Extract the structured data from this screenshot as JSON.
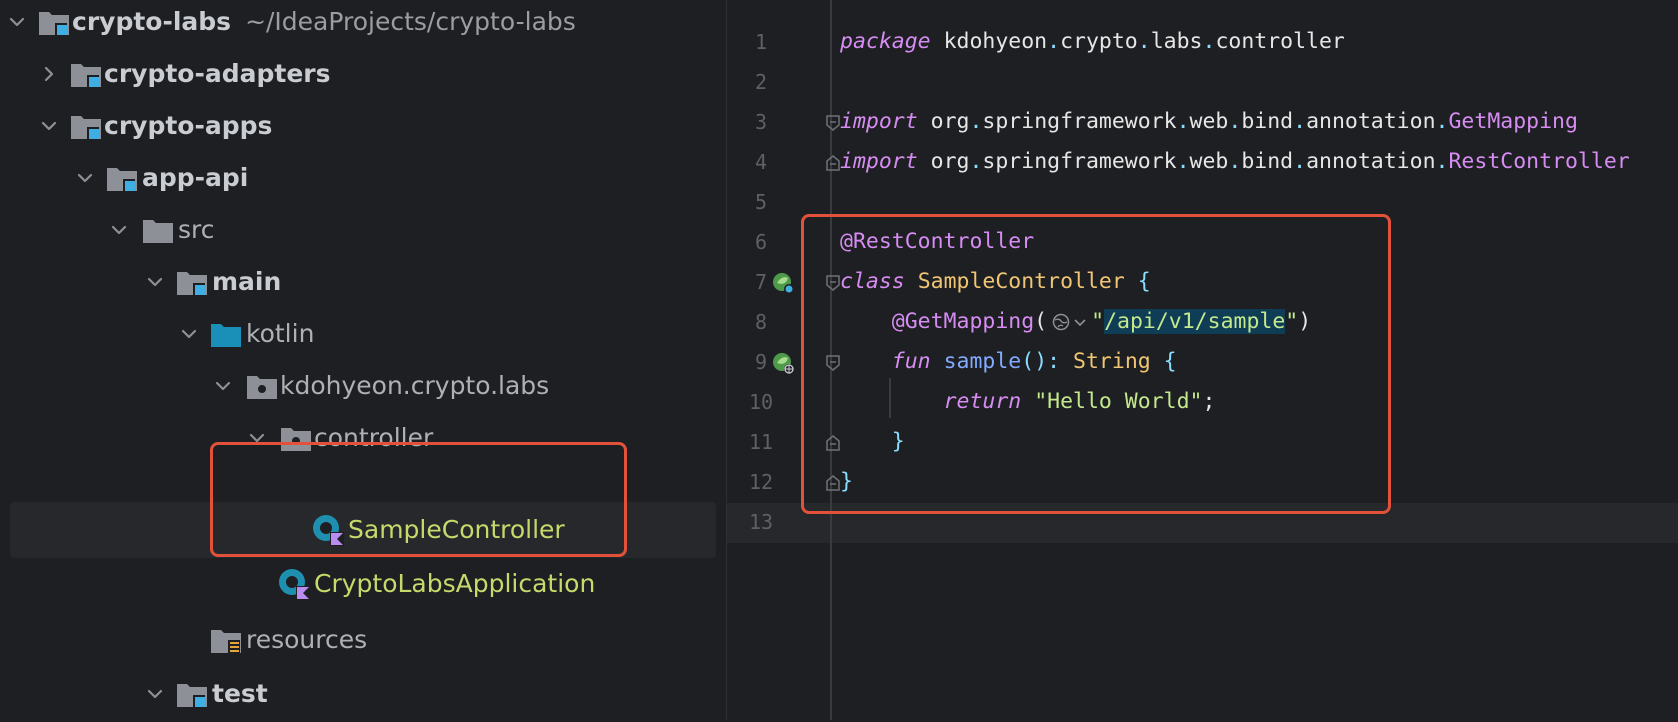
{
  "project_tree": {
    "root": {
      "name": "crypto-labs",
      "path": "~/IdeaProjects/crypto-labs"
    },
    "items": [
      {
        "label": "crypto-adapters"
      },
      {
        "label": "crypto-apps"
      },
      {
        "label": "app-api"
      },
      {
        "label": "src"
      },
      {
        "label": "main"
      },
      {
        "label": "kotlin"
      },
      {
        "label": "kdohyeon.crypto.labs"
      },
      {
        "label": "controller"
      },
      {
        "label": "SampleController"
      },
      {
        "label": "CryptoLabsApplication"
      },
      {
        "label": "resources"
      },
      {
        "label": "test"
      }
    ]
  },
  "editor": {
    "line_numbers": [
      "1",
      "2",
      "3",
      "4",
      "5",
      "6",
      "7",
      "8",
      "9",
      "10",
      "11",
      "12",
      "13"
    ],
    "lines": {
      "l1": {
        "kw": "package",
        "pkg1": "kdohyeon",
        "pkg2": "crypto",
        "pkg3": "labs",
        "pkg4": "controller"
      },
      "l3": {
        "kw": "import",
        "p1": "org",
        "p2": "springframework",
        "p3": "web",
        "p4": "bind",
        "p5": "annotation",
        "cls": "GetMapping"
      },
      "l4": {
        "kw": "import",
        "p1": "org",
        "p2": "springframework",
        "p3": "web",
        "p4": "bind",
        "p5": "annotation",
        "cls": "RestController"
      },
      "l6": {
        "anno": "@RestController"
      },
      "l7": {
        "kw": "class",
        "name": "SampleController",
        "brace": "{"
      },
      "l8": {
        "anno": "@GetMapping",
        "open": "(",
        "quote_open": "\"",
        "path": "/api/v1/sample",
        "quote_close": "\"",
        "close": ")"
      },
      "l9": {
        "kw": "fun",
        "name": "sample",
        "parens": "()",
        "colon": ":",
        "type": "String",
        "brace": "{"
      },
      "l10": {
        "kw": "return",
        "str": "\"Hello World\"",
        "semi": ";"
      },
      "l11": {
        "brace": "}"
      },
      "l12": {
        "brace": "}"
      }
    }
  },
  "colors": {
    "highlight_box": "#e2513a",
    "keyword": "#d68cf2",
    "class_name": "#f0c674",
    "function": "#82aaff",
    "string": "#c3e88d",
    "kotlin_file": "#c8d96b"
  },
  "icons": {
    "module": "module-folder-icon",
    "folder": "folder-icon",
    "source_root": "source-root-icon",
    "package": "package-icon",
    "kotlin_class": "kotlin-class-icon",
    "resources": "resources-folder-icon",
    "spring_bean": "spring-bean-gutter-icon",
    "web_endpoint": "web-endpoint-gutter-icon"
  }
}
